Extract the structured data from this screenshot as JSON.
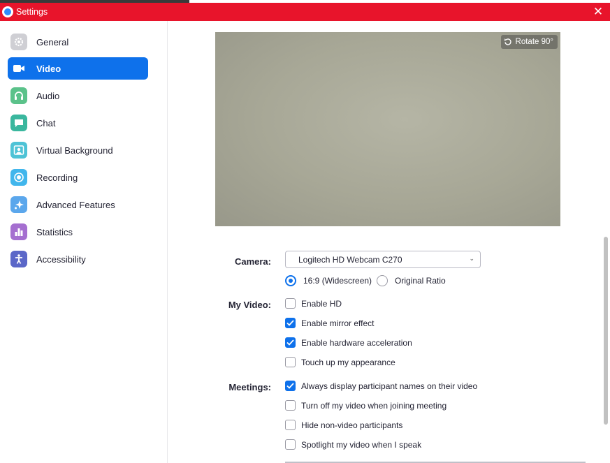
{
  "window": {
    "title": "Settings"
  },
  "sidebar": {
    "items": [
      {
        "label": "General",
        "icon": "gear-icon",
        "color": "#cfcfd4",
        "active": false
      },
      {
        "label": "Video",
        "icon": "video-camera-icon",
        "color": "#0e71eb",
        "active": true
      },
      {
        "label": "Audio",
        "icon": "headphones-icon",
        "color": "#5bc28a",
        "active": false
      },
      {
        "label": "Chat",
        "icon": "chat-bubble-icon",
        "color": "#3ab79e",
        "active": false
      },
      {
        "label": "Virtual Background",
        "icon": "person-background-icon",
        "color": "#4ec3d6",
        "active": false
      },
      {
        "label": "Recording",
        "icon": "record-icon",
        "color": "#41b6ec",
        "active": false
      },
      {
        "label": "Advanced Features",
        "icon": "sparkle-icon",
        "color": "#5ba7ec",
        "active": false
      },
      {
        "label": "Statistics",
        "icon": "bar-chart-icon",
        "color": "#a56fd0",
        "active": false
      },
      {
        "label": "Accessibility",
        "icon": "accessibility-person-icon",
        "color": "#5b67c8",
        "active": false
      }
    ]
  },
  "video": {
    "rotate_label": "Rotate 90°",
    "camera_label": "Camera:",
    "camera_value": "Logitech HD Webcam C270",
    "aspect_options": [
      {
        "label": "16:9 (Widescreen)",
        "selected": true
      },
      {
        "label": "Original Ratio",
        "selected": false
      }
    ],
    "my_video_label": "My Video:",
    "my_video_options": [
      {
        "label": "Enable HD",
        "checked": false
      },
      {
        "label": "Enable mirror effect",
        "checked": true
      },
      {
        "label": "Enable hardware acceleration",
        "checked": true
      },
      {
        "label": "Touch up my appearance",
        "checked": false
      }
    ],
    "meetings_label": "Meetings:",
    "meetings_options": [
      {
        "label": "Always display participant names on their video",
        "checked": true
      },
      {
        "label": "Turn off my video when joining meeting",
        "checked": false
      },
      {
        "label": "Hide non-video participants",
        "checked": false
      },
      {
        "label": "Spotlight my video when I speak",
        "checked": false
      }
    ]
  },
  "colors": {
    "titlebar": "#e8142b",
    "accent": "#0e71eb"
  }
}
